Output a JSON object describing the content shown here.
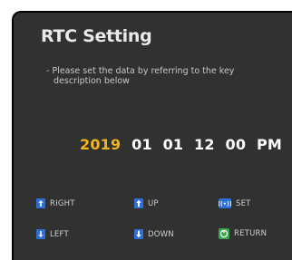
{
  "screen": {
    "title": "RTC Setting",
    "description_line1": "- Please set the data by referring to the key",
    "description_line2": "description below"
  },
  "datetime": {
    "year": "2019",
    "month": "01",
    "day": "01",
    "hour": "12",
    "minute": "00",
    "ampm": "PM"
  },
  "keys": {
    "right": {
      "label": "RIGHT",
      "icon": "right-key-icon"
    },
    "up": {
      "label": "UP",
      "icon": "up-key-icon"
    },
    "set": {
      "label": "SET",
      "icon": "set-key-icon"
    },
    "left": {
      "label": "LEFT",
      "icon": "left-key-icon"
    },
    "down": {
      "label": "DOWN",
      "icon": "down-key-icon"
    },
    "return": {
      "label": "RETURN",
      "icon": "return-key-icon"
    }
  },
  "colors": {
    "panel": "#313131",
    "accent_year": "#f3b51c",
    "key_blue": "#2e6fd6",
    "key_green": "#3aa84a"
  }
}
